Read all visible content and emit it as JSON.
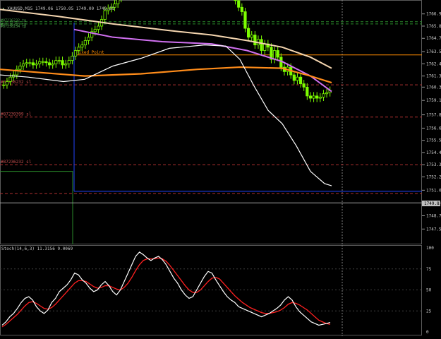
{
  "main": {
    "title": "XAUUSD,M15",
    "ohlc": "1749.06 1750.05 1749.00 1749.81",
    "ylim": [
      1746.5,
      1767.9
    ],
    "price_ticks": [
      "1766.90",
      "1765.80",
      "1764.70",
      "1763.50",
      "1762.40",
      "1761.30",
      "1760.30",
      "1759.10",
      "1757.80",
      "1756.60",
      "1755.50",
      "1754.40",
      "1753.30",
      "1752.20",
      "1751.00",
      "1749.80",
      "1748.70",
      "1747.50"
    ],
    "current_price": "1749.81",
    "current_price_value": 1749.81,
    "level_labels": [
      "Fixed Point",
      "#87236232 sl",
      "#87239399 sl",
      "#87236232 sl",
      "#87236232 tp",
      "#87236233 tp",
      "#87236234 tp"
    ],
    "colors": {
      "bull": "#7cfc00",
      "bear": "#7cfc00",
      "ma_white": "#ffffff",
      "ma_orange": "#ff8c1a",
      "ma_violet": "#d070f0",
      "ma_peach": "#f5d6b0",
      "sl_line": "#b03030",
      "tp_line": "#2a8a2a",
      "fixed_line": "#ff8c00",
      "blue_line": "#2244ff",
      "price_box": "#c0c0c0"
    }
  },
  "osc": {
    "title": "Stoch(14,6,3) 11.3156 9.0069",
    "ticks": [
      "100",
      "75",
      "50",
      "25",
      "0"
    ],
    "colors": {
      "main": "#ffffff",
      "signal": "#ff2020"
    }
  },
  "chart_data": {
    "type": "candlestick",
    "title": "XAUUSD,M15",
    "series": [
      {
        "name": "Stoch(14,6,3)",
        "values": [
          8,
          12,
          18,
          22,
          28,
          35,
          40,
          42,
          38,
          30,
          25,
          22,
          26,
          35,
          40,
          48,
          52,
          56,
          62,
          70,
          68,
          62,
          58,
          52,
          48,
          50,
          56,
          60,
          55,
          48,
          44,
          50,
          60,
          70,
          80,
          90,
          95,
          92,
          88,
          85,
          88,
          90,
          86,
          80,
          72,
          64,
          58,
          50,
          44,
          40,
          42,
          50,
          58,
          66,
          72,
          70,
          62,
          55,
          48,
          42,
          38,
          35,
          30,
          28,
          26,
          24,
          22,
          20,
          18,
          20,
          22,
          25,
          28,
          32,
          38,
          42,
          38,
          30,
          24,
          20,
          16,
          12,
          10,
          8,
          9,
          10,
          11.3
        ]
      },
      {
        "name": "signal",
        "values": [
          6,
          9,
          13,
          17,
          21,
          26,
          31,
          35,
          36,
          34,
          31,
          28,
          27,
          29,
          33,
          38,
          43,
          48,
          53,
          58,
          61,
          61,
          60,
          57,
          54,
          52,
          53,
          55,
          55,
          53,
          51,
          50,
          53,
          58,
          65,
          73,
          80,
          85,
          87,
          87,
          87,
          88,
          87,
          84,
          79,
          73,
          67,
          61,
          55,
          50,
          47,
          47,
          50,
          55,
          60,
          64,
          65,
          63,
          58,
          53,
          48,
          43,
          39,
          35,
          32,
          29,
          27,
          25,
          23,
          22,
          22,
          23,
          24,
          26,
          29,
          33,
          35,
          34,
          32,
          29,
          26,
          22,
          18,
          14,
          12,
          10,
          9.0
        ]
      }
    ]
  }
}
